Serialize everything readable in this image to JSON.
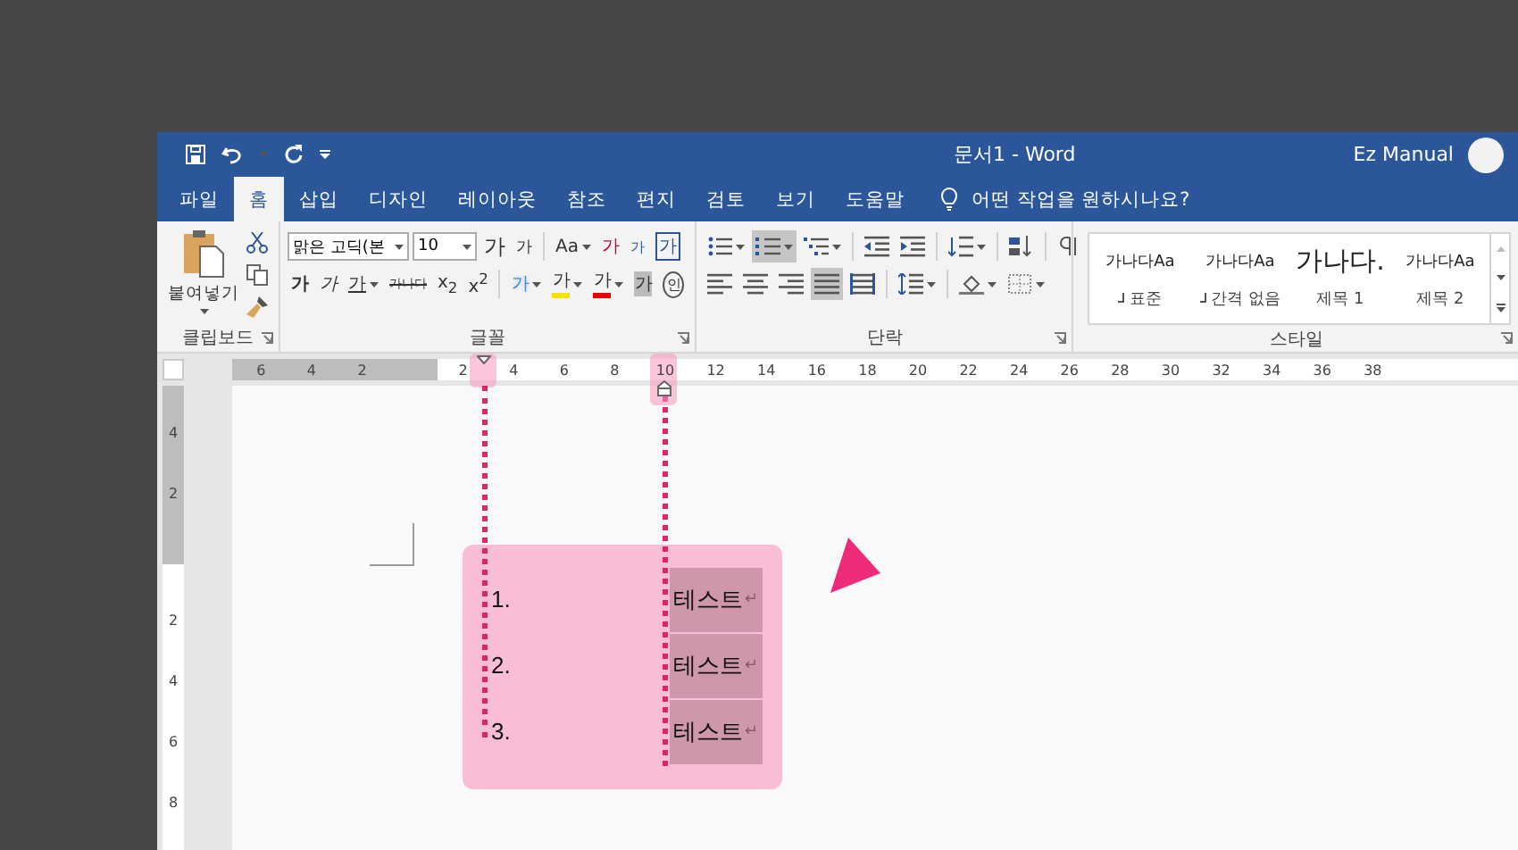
{
  "window": {
    "title": "문서1  -  Word",
    "user": "Ez Manual"
  },
  "tabs": [
    {
      "label": "파일",
      "selected": false
    },
    {
      "label": "홈",
      "selected": true
    },
    {
      "label": "삽입",
      "selected": false
    },
    {
      "label": "디자인",
      "selected": false
    },
    {
      "label": "레이아웃",
      "selected": false
    },
    {
      "label": "참조",
      "selected": false
    },
    {
      "label": "편지",
      "selected": false
    },
    {
      "label": "검토",
      "selected": false
    },
    {
      "label": "보기",
      "selected": false
    },
    {
      "label": "도움말",
      "selected": false
    }
  ],
  "tell_me": {
    "placeholder": "어떤 작업을 원하시나요?"
  },
  "clipboard": {
    "paste_label": "붙여넣기",
    "group_label": "클립보드"
  },
  "font": {
    "name": "맑은 고딕(본",
    "size": "10",
    "group_label": "글꼴",
    "top_buttons": [
      {
        "kind": "grow",
        "label": "가"
      },
      {
        "kind": "shrink",
        "label": "가"
      },
      {
        "kind": "case",
        "label": "Aa"
      },
      {
        "kind": "clear",
        "label": "가"
      },
      {
        "kind": "phonetic",
        "label": "가"
      },
      {
        "kind": "border",
        "label": "가"
      }
    ],
    "bottom_buttons": [
      {
        "kind": "bold",
        "label": "가"
      },
      {
        "kind": "italic",
        "label": "가"
      },
      {
        "kind": "underline",
        "label": "가"
      },
      {
        "kind": "strike",
        "label": "가나다"
      },
      {
        "kind": "subscript",
        "label": "x$_{2}$"
      },
      {
        "kind": "superscript",
        "label": "x$^{2}$"
      },
      {
        "kind": "effects",
        "label": "가"
      },
      {
        "kind": "highlight",
        "label": "가"
      },
      {
        "kind": "color",
        "label": "가"
      },
      {
        "kind": "shading",
        "label": "가"
      },
      {
        "kind": "enclosed",
        "label": "인"
      }
    ]
  },
  "paragraph": {
    "group_label": "단락",
    "top_buttons": [
      {
        "kind": "bullets",
        "selected": false
      },
      {
        "kind": "numbering",
        "selected": true
      },
      {
        "kind": "multilevel",
        "selected": false
      },
      {
        "kind": "outdent",
        "selected": false
      },
      {
        "kind": "indent",
        "selected": false
      },
      {
        "kind": "asian",
        "selected": false
      },
      {
        "kind": "sort",
        "selected": false
      },
      {
        "kind": "marks",
        "selected": false
      }
    ],
    "bottom_buttons": [
      {
        "kind": "left",
        "selected": false
      },
      {
        "kind": "center",
        "selected": false
      },
      {
        "kind": "right",
        "selected": false
      },
      {
        "kind": "justify",
        "selected": true
      },
      {
        "kind": "distribute",
        "selected": false
      },
      {
        "kind": "spacing",
        "selected": false
      },
      {
        "kind": "bucket",
        "selected": false
      },
      {
        "kind": "borders",
        "selected": false
      }
    ]
  },
  "styles": {
    "group_label": "스타일",
    "items": [
      {
        "preview": "가나다Aa",
        "name": "표준",
        "large": false,
        "para_mark": true
      },
      {
        "preview": "가나다Aa",
        "name": "간격 없음",
        "large": false,
        "para_mark": true
      },
      {
        "preview": "가나다.",
        "name": "제목 1",
        "large": true,
        "para_mark": false
      },
      {
        "preview": "가나다Aa",
        "name": "제목 2",
        "large": false,
        "para_mark": false
      }
    ]
  },
  "ruler": {
    "left_numbers": [
      "6",
      "4",
      "2"
    ],
    "numbers": [
      "2",
      "4",
      "6",
      "8",
      "10",
      "12",
      "14",
      "16",
      "18",
      "20",
      "22",
      "24",
      "26",
      "28",
      "30",
      "32",
      "34",
      "36",
      "38"
    ]
  },
  "vertical_ruler": {
    "top_numbers": [
      "4",
      "2"
    ],
    "numbers": [
      "2",
      "4",
      "6",
      "8"
    ]
  },
  "document": {
    "list": [
      {
        "number": "1.",
        "text": "테스트",
        "mark": "↵",
        "selected": true
      },
      {
        "number": "2.",
        "text": "테스트",
        "mark": "↵",
        "selected": true
      },
      {
        "number": "3.",
        "text": "테스트",
        "mark": "↵",
        "selected": true
      }
    ]
  }
}
